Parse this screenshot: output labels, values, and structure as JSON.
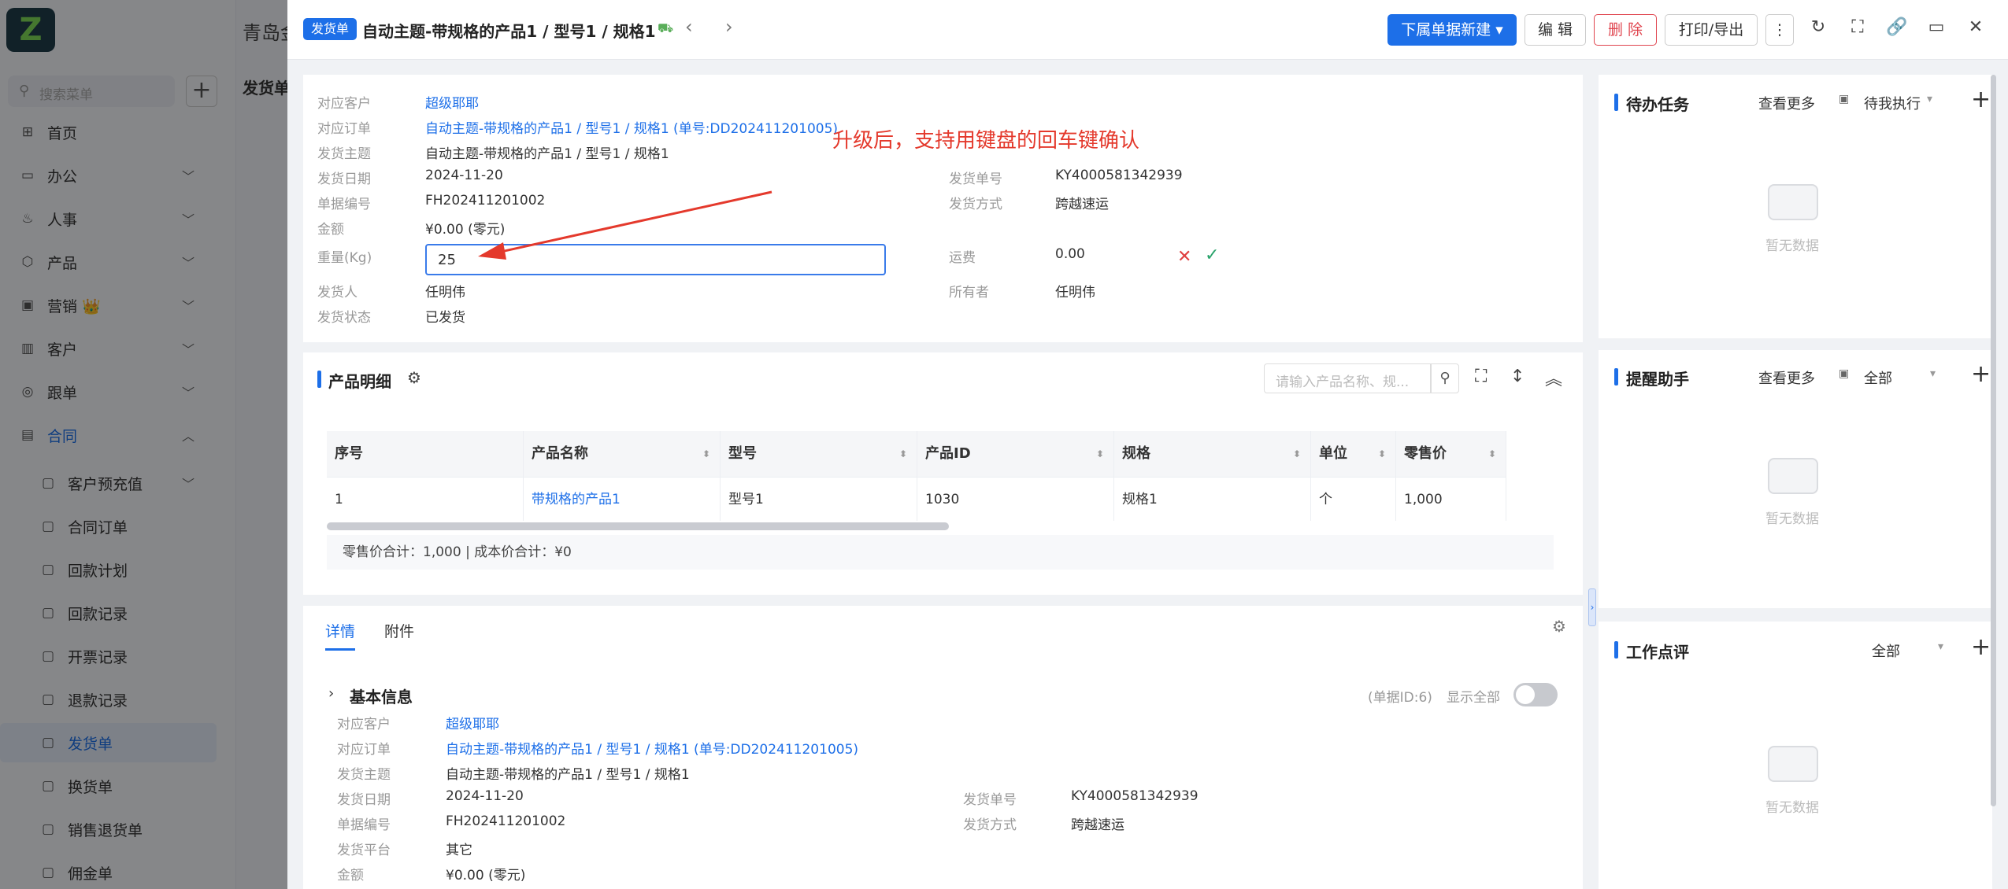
{
  "sidebar": {
    "logo": "Z",
    "company": "青岛金",
    "search_placeholder": "搜索菜单",
    "items": [
      {
        "label": "首页",
        "icon": "home-icon",
        "glyph": "⊞"
      },
      {
        "label": "办公",
        "icon": "office-icon",
        "glyph": "▭"
      },
      {
        "label": "人事",
        "icon": "hr-icon",
        "glyph": "♨"
      },
      {
        "label": "产品",
        "icon": "product-icon",
        "glyph": "⬡"
      },
      {
        "label": "营销 👑",
        "icon": "marketing-icon",
        "glyph": "▣"
      },
      {
        "label": "客户",
        "icon": "customer-icon",
        "glyph": "▥"
      },
      {
        "label": "跟单",
        "icon": "follow-icon",
        "glyph": "◎"
      },
      {
        "label": "合同",
        "icon": "contract-icon",
        "glyph": "▤"
      }
    ],
    "subitems": [
      {
        "label": "客户预充值",
        "icon": "prepay-icon"
      },
      {
        "label": "合同订单",
        "icon": "order-icon"
      },
      {
        "label": "回款计划",
        "icon": "payment-plan-icon"
      },
      {
        "label": "回款记录",
        "icon": "payment-record-icon"
      },
      {
        "label": "开票记录",
        "icon": "invoice-icon"
      },
      {
        "label": "退款记录",
        "icon": "refund-icon"
      },
      {
        "label": "发货单",
        "icon": "shipment-icon"
      },
      {
        "label": "换货单",
        "icon": "exchange-icon"
      },
      {
        "label": "销售退货单",
        "icon": "return-icon"
      },
      {
        "label": "佣金单",
        "icon": "commission-icon"
      }
    ],
    "page_title": "发货单"
  },
  "header": {
    "badge": "发货单",
    "title": "自动主题-带规格的产品1 / 型号1 / 规格1",
    "buttons": {
      "new_sub": "下属单据新建",
      "edit": "编 辑",
      "delete": "删 除",
      "print": "打印/导出"
    }
  },
  "info": {
    "customer_label": "对应客户",
    "customer": "超级耶耶",
    "order_label": "对应订单",
    "order": "自动主题-带规格的产品1 / 型号1 / 规格1 (单号:DD202411201005)",
    "subject_label": "发货主题",
    "subject": "自动主题-带规格的产品1 / 型号1 / 规格1",
    "date_label": "发货日期",
    "date": "2024-11-20",
    "docno_label": "单据编号",
    "docno": "FH202411201002",
    "amount_label": "金额",
    "amount": "¥0.00 (零元)",
    "weight_label": "重量(Kg)",
    "weight": "25",
    "shipper_label": "发货人",
    "shipper": "任明伟",
    "status_label": "发货状态",
    "status": "已发货",
    "shipno_label": "发货单号",
    "shipno": "KY4000581342939",
    "method_label": "发货方式",
    "method": "跨越速运",
    "freight_label": "运费",
    "freight": "0.00",
    "owner_label": "所有者",
    "owner": "任明伟"
  },
  "annotation": "升级后，支持用键盘的回车键确认",
  "products": {
    "title": "产品明细",
    "search_placeholder": "请输入产品名称、规...",
    "columns": [
      "序号",
      "产品名称",
      "型号",
      "产品ID",
      "规格",
      "单位",
      "零售价"
    ],
    "rows": [
      [
        "1",
        "带规格的产品1",
        "型号1",
        "1030",
        "规格1",
        "个",
        "1,000"
      ]
    ],
    "summary": "零售价合计：1,000 |    成本价合计：¥0"
  },
  "tabs": {
    "detail": "详情",
    "attachment": "附件"
  },
  "basic": {
    "title": "基本信息",
    "doc_id": "(单据ID:6)",
    "show_all": "显示全部",
    "platform_label": "发货平台",
    "platform": "其它"
  },
  "right": {
    "todo": {
      "title": "待办任务",
      "more": "查看更多",
      "filter": "待我执行",
      "empty": "暂无数据"
    },
    "reminder": {
      "title": "提醒助手",
      "more": "查看更多",
      "filter": "全部",
      "empty": "暂无数据"
    },
    "review": {
      "title": "工作点评",
      "filter": "全部",
      "empty": "暂无数据"
    }
  },
  "colors": {
    "accent": "#1d6fe8",
    "danger": "#e0454f",
    "annotation": "#e4392c"
  }
}
